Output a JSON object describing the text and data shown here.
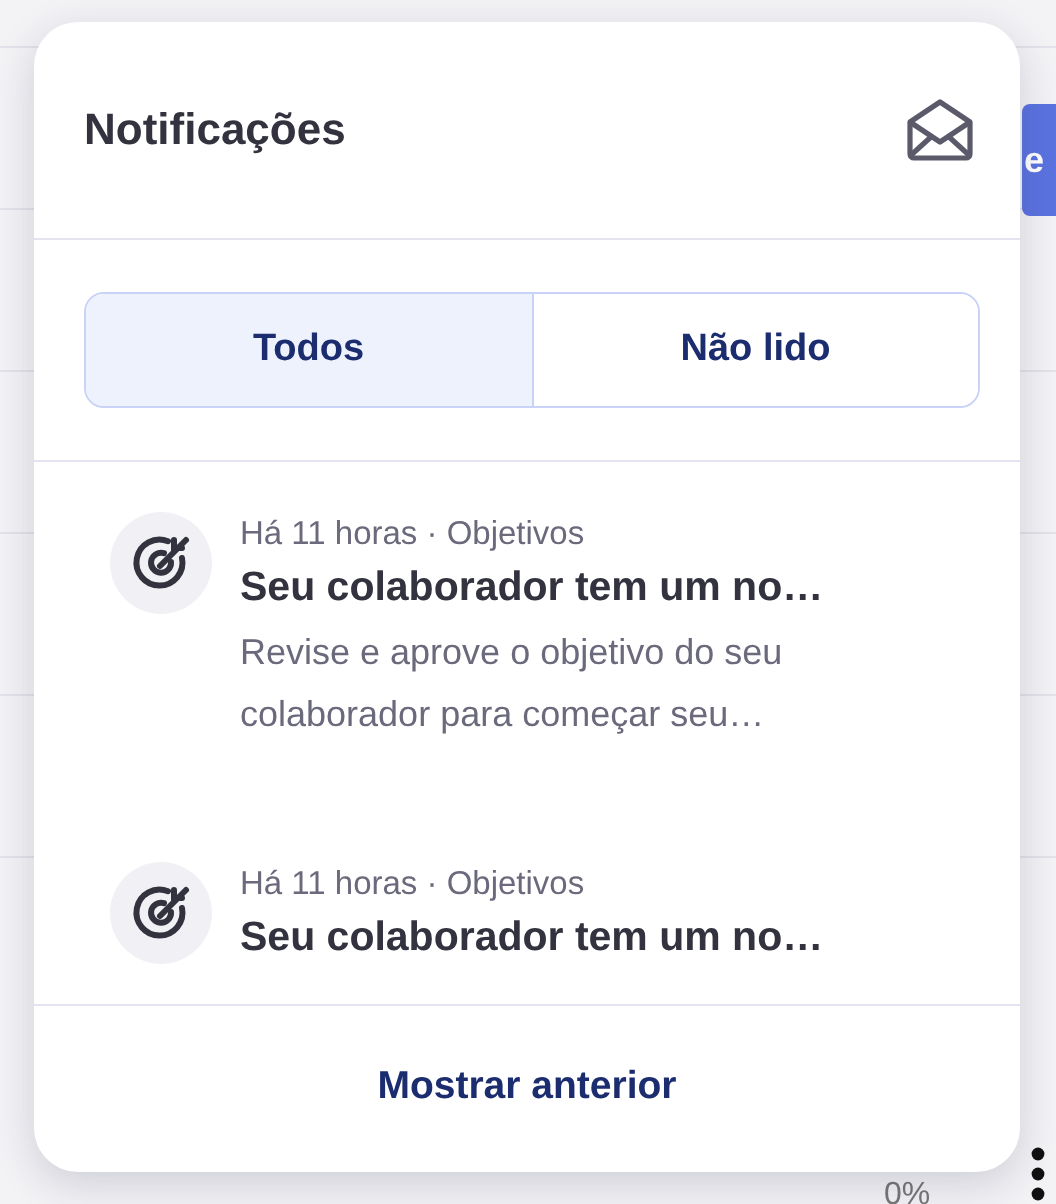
{
  "background": {
    "button_label": "e",
    "percent": "0%"
  },
  "panel": {
    "title": "Notificações",
    "tabs": [
      {
        "label": "Todos",
        "selected": true
      },
      {
        "label": "Não lido",
        "selected": false
      }
    ],
    "notifications": [
      {
        "meta": "Há 11 horas · Objetivos",
        "title": "Seu colaborador tem um no…",
        "description": "Revise e aprove o objetivo do seu colaborador para começar seu…"
      },
      {
        "meta": "Há 11 horas · Objetivos",
        "title": "Seu colaborador tem um no…"
      }
    ],
    "footer_link": "Mostrar anterior"
  }
}
